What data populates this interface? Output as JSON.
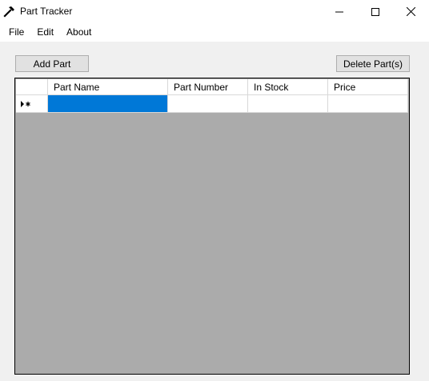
{
  "window": {
    "title": "Part Tracker",
    "icon": "hammer-icon",
    "controls": [
      "minimize-icon",
      "maximize-icon",
      "close-icon"
    ]
  },
  "menu": {
    "items": [
      "File",
      "Edit",
      "About"
    ]
  },
  "toolbar": {
    "add_label": "Add Part",
    "delete_label": "Delete Part(s)"
  },
  "grid": {
    "columns": [
      "Part Name",
      "Part Number",
      "In Stock",
      "Price"
    ],
    "rows": [
      {
        "indicator": "current-new-row-icon",
        "cells": [
          "",
          "",
          "",
          ""
        ],
        "selected_column": 0
      }
    ]
  },
  "colors": {
    "selection": "#0078d7",
    "grid_background": "#ababab",
    "window_background": "#f0f0f0"
  }
}
